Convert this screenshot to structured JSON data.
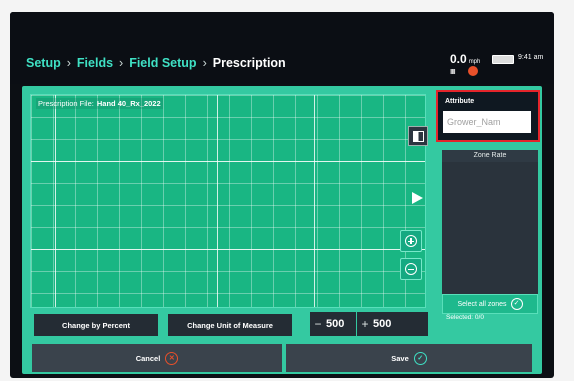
{
  "breadcrumb": {
    "items": [
      "Setup",
      "Fields",
      "Field Setup",
      "Prescription"
    ]
  },
  "status": {
    "speed": "0.0",
    "speed_unit": "mph",
    "time": "9:41 am"
  },
  "prescription": {
    "label": "Prescription File:",
    "file": "Hand 40_Rx_2022"
  },
  "attribute": {
    "label": "Attribute",
    "value": "Grower_Nam"
  },
  "zones": {
    "header": "Zone Rate",
    "select_all": "Select all zones",
    "selected_text": "Selected: 0/0"
  },
  "buttons": {
    "change_percent": "Change by Percent",
    "change_unit": "Change Unit of Measure",
    "minus": "−",
    "minus_value": "500",
    "plus": "+",
    "plus_value": "500",
    "cancel": "Cancel",
    "save": "Save"
  },
  "colors": {
    "accent": "#34c9a1",
    "breadcrumb": "#3fe0c4",
    "highlight": "#e5252b"
  },
  "icons": {
    "map_tiles": "tiles-icon",
    "zoom_in": "zoom-in-icon",
    "zoom_out": "zoom-out-icon",
    "vehicle": "arrow-icon"
  }
}
